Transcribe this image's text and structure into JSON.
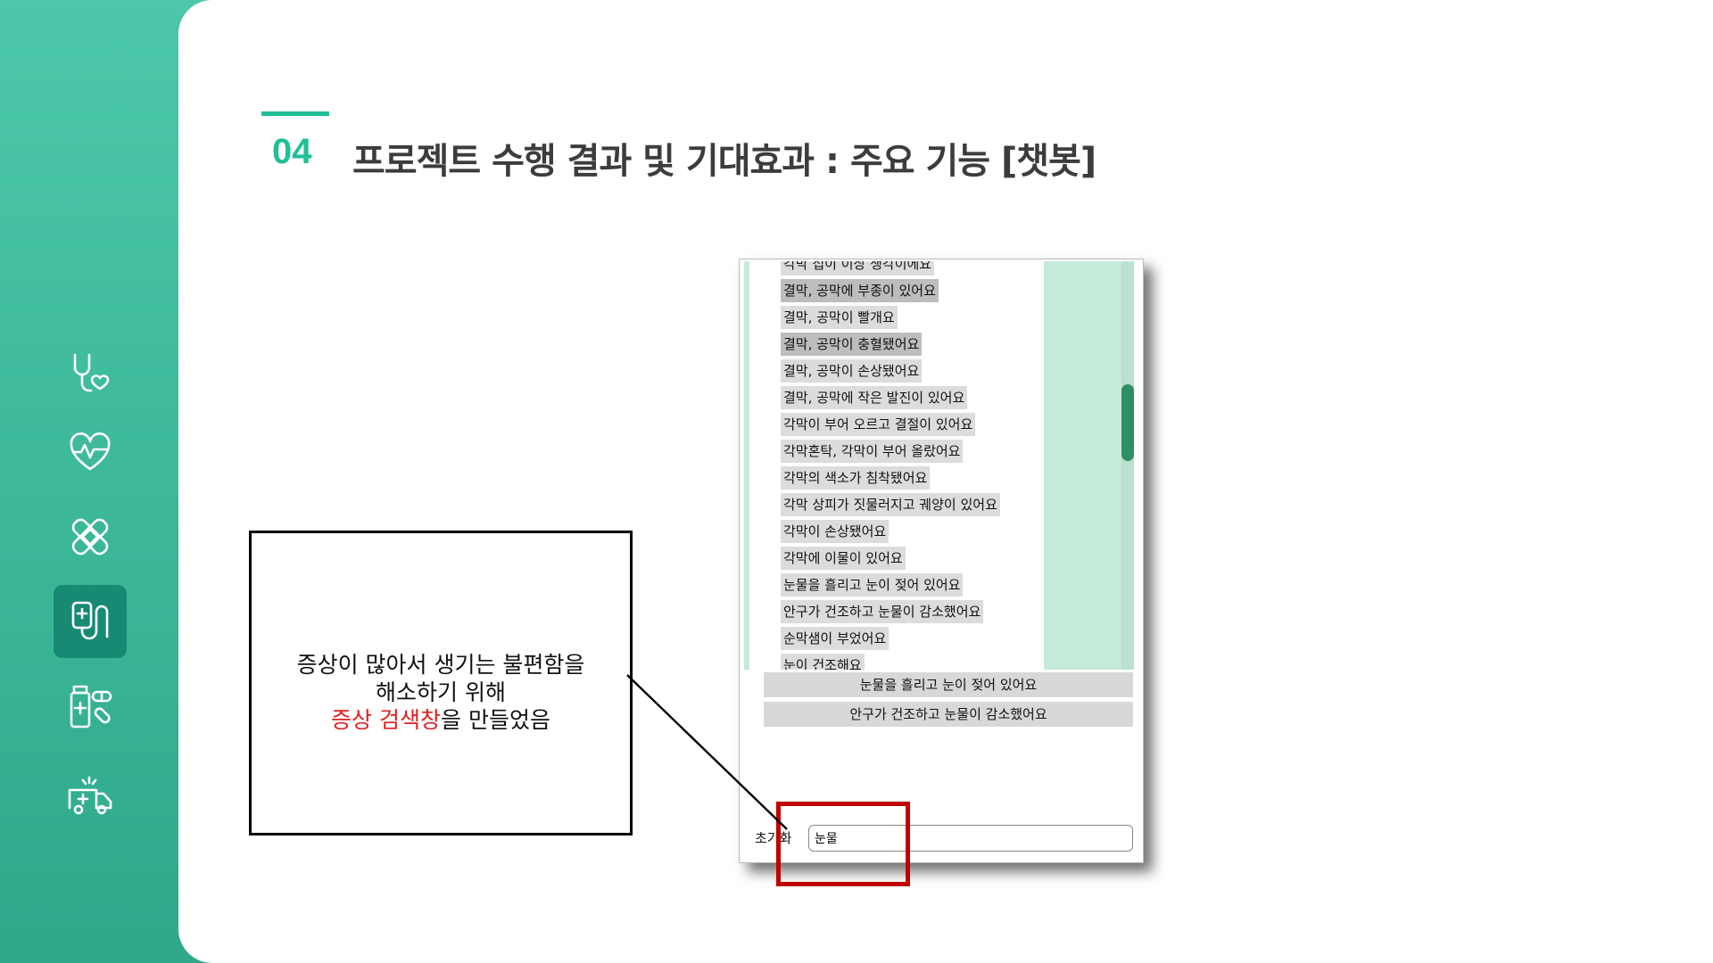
{
  "section": {
    "number": "04",
    "title": "프로젝트 수행 결과 및 기대효과 : 주요 기능 [챗봇]"
  },
  "sidebar": {
    "icons": [
      {
        "name": "stethoscope-heart-icon",
        "active": false
      },
      {
        "name": "heartbeat-icon",
        "active": false
      },
      {
        "name": "bandage-icon",
        "active": false
      },
      {
        "name": "iv-bag-icon",
        "active": true
      },
      {
        "name": "medicine-bottle-pills-icon",
        "active": false
      },
      {
        "name": "ambulance-icon",
        "active": false
      }
    ]
  },
  "callout": {
    "line1": "증상이 많아서 생기는 불편함을",
    "line2": "해소하기 위해",
    "highlight": "증상 검색창",
    "line3_rest": "을 만들었음",
    "highlight_color": "#e02020"
  },
  "chatbot": {
    "symptom_list": [
      "각막 접이 이상 생각이에요",
      "결막, 공막에 부종이 있어요",
      "결막, 공막이 빨개요",
      "결막, 공막이 충혈됐어요",
      "결막, 공막이 손상됐어요",
      "결막, 공막에 작은 발진이 있어요",
      "각막이 부어 오르고 결절이 있어요",
      "각막혼탁, 각막이 부어 올랐어요",
      "각막의 색소가 침착됐어요",
      "각막 상피가 짓물러지고 궤양이 있어요",
      "각막이 손상됐어요",
      "각막에 이물이 있어요",
      "눈물을 흘리고 눈이 젖어 있어요",
      "안구가 건조하고 눈물이 감소했어요",
      "순막샘이 부었어요",
      "눈이 건조해요"
    ],
    "result_buttons": [
      "눈물을 흘리고 눈이 젖어 있어요",
      "안구가 건조하고 눈물이 감소했어요"
    ],
    "reset_label": "초기화",
    "search_value": "눈물"
  },
  "colors": {
    "accent": "#1fbf98",
    "sidebar": "#3db99a",
    "list_panel": "#c6ead8",
    "scroll_thumb": "#2e8f62",
    "highlight_box": "#c00000"
  }
}
